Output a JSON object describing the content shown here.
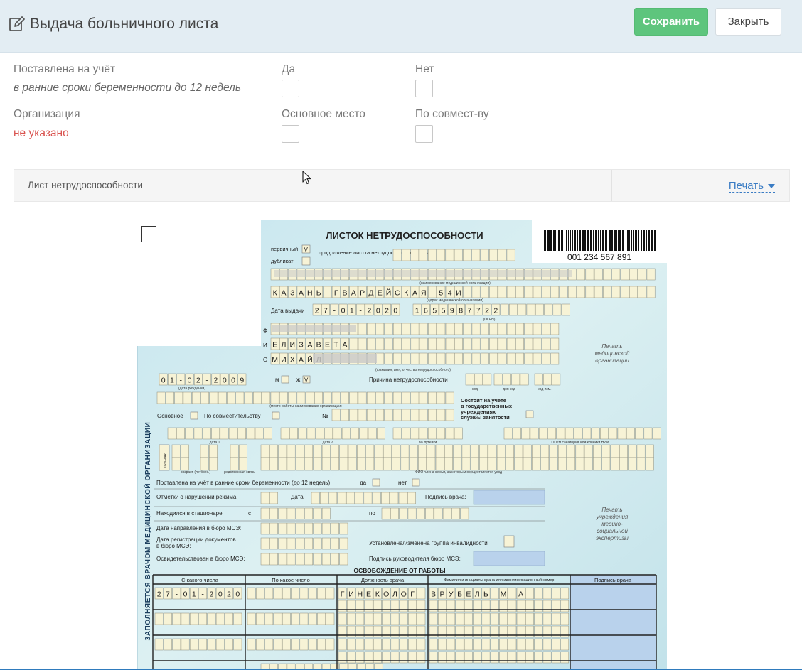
{
  "header": {
    "title": "Выдача больничного листа",
    "save_label": "Сохранить",
    "close_label": "Закрыть"
  },
  "form": {
    "registered_label": "Поставлена на учёт",
    "registered_sub": "в ранние сроки беременности до 12 недель",
    "yes_label": "Да",
    "no_label": "Нет",
    "organization_label": "Организация",
    "organization_value": "не указано",
    "main_place_label": "Основное место",
    "combined_label": "По совмест-ву"
  },
  "panel": {
    "title": "Лист нетрудоспособности",
    "print_label": "Печать"
  },
  "document": {
    "heading": "ЛИСТОК НЕТРУДОСПОСОБНОСТИ",
    "barcode_number": "001 234 567 891",
    "primary": "первичный",
    "primary_mark": "V",
    "duplicate": "дубликат",
    "continuation": "продолжение листка нетрудоспособности №",
    "org_caption": "(наименование медицинской организации)",
    "address": "КАЗАНЬ ГВАРДЕЙСКАЯ 54И",
    "address_caption": "(адрес медицинской организации)",
    "issue_date_label": "Дата выдачи",
    "issue_date": "27-01-2020",
    "ogrn": "1655987722",
    "ogrn_caption": "(ОГРН)",
    "first_name": "ЕЛИЗАВЕТА",
    "patronymic": "МИХАЙЛ",
    "fio_caption": "(фамилия, имя, отчество нетрудоспособного)",
    "stamp_med": "Печать медицинской организации",
    "birth_date": "01-02-2009",
    "birth_caption": "(дата рождения)",
    "gender_m": "м",
    "gender_f": "ж",
    "gender_mark": "V",
    "reason_label": "Причина нетрудоспособности",
    "reason_code": "код",
    "reason_extra": "доп код",
    "reason_change": "код изм.",
    "work_caption": "(место работы-наименование организации)",
    "employment_office": "Состоит на учёте в государственных учреждениях службы занятости",
    "main_job": "Основное",
    "combined_job": "По совместительству",
    "number_sign": "№",
    "date1": "дата 1",
    "date2": "дата 2",
    "voucher": "№ путевки",
    "sanatorium": "ОГРН санатория или клиники НИИ",
    "care": "по уходу",
    "age": "возраст (лет/мес.)",
    "relation": "родственная связь",
    "family_fio": "ФИО члена семьи, за которым осуществляется уход",
    "early_pregnancy": "Поставлена на учёт в ранние сроки беременности (до 12 недель)",
    "yes": "да",
    "no": "нет",
    "violations": "Отметки о нарушении режима",
    "date_label": "Дата",
    "doctor_sign": "Подпись врача:",
    "hospital": "Находился в стационаре:",
    "from": "с",
    "to": "по",
    "mse_referral": "Дата направления в бюро МСЭ:",
    "mse_registration": "Дата регистрации документов в бюро МСЭ:",
    "disability_group": "Установлена/изменена группа инвалидности",
    "mse_exam": "Освидетельствован в бюро МСЭ:",
    "mse_head_sign": "Подпись руководителя бюро МСЭ:",
    "stamp_mse": "Печать учреждения медико-социальной экспертизы",
    "release_heading": "ОСВОБОЖДЕНИЕ ОТ РАБОТЫ",
    "col_from": "С какого числа",
    "col_to": "По какое число",
    "col_position": "Должность врача",
    "col_doctor": "Фамилия и инициалы врача или идентификационный номер",
    "col_sign": "Подпись врача",
    "row1_from": "27-01-2020",
    "row1_position": "ГИНЕКОЛОГ",
    "row1_doctor": "ВРУБЕЛЬ М А",
    "side_label": "ЗАПОЛНЯЕТСЯ ВРАЧОМ МЕДИЦИНСКОЙ ОРГАНИЗАЦИИ"
  }
}
